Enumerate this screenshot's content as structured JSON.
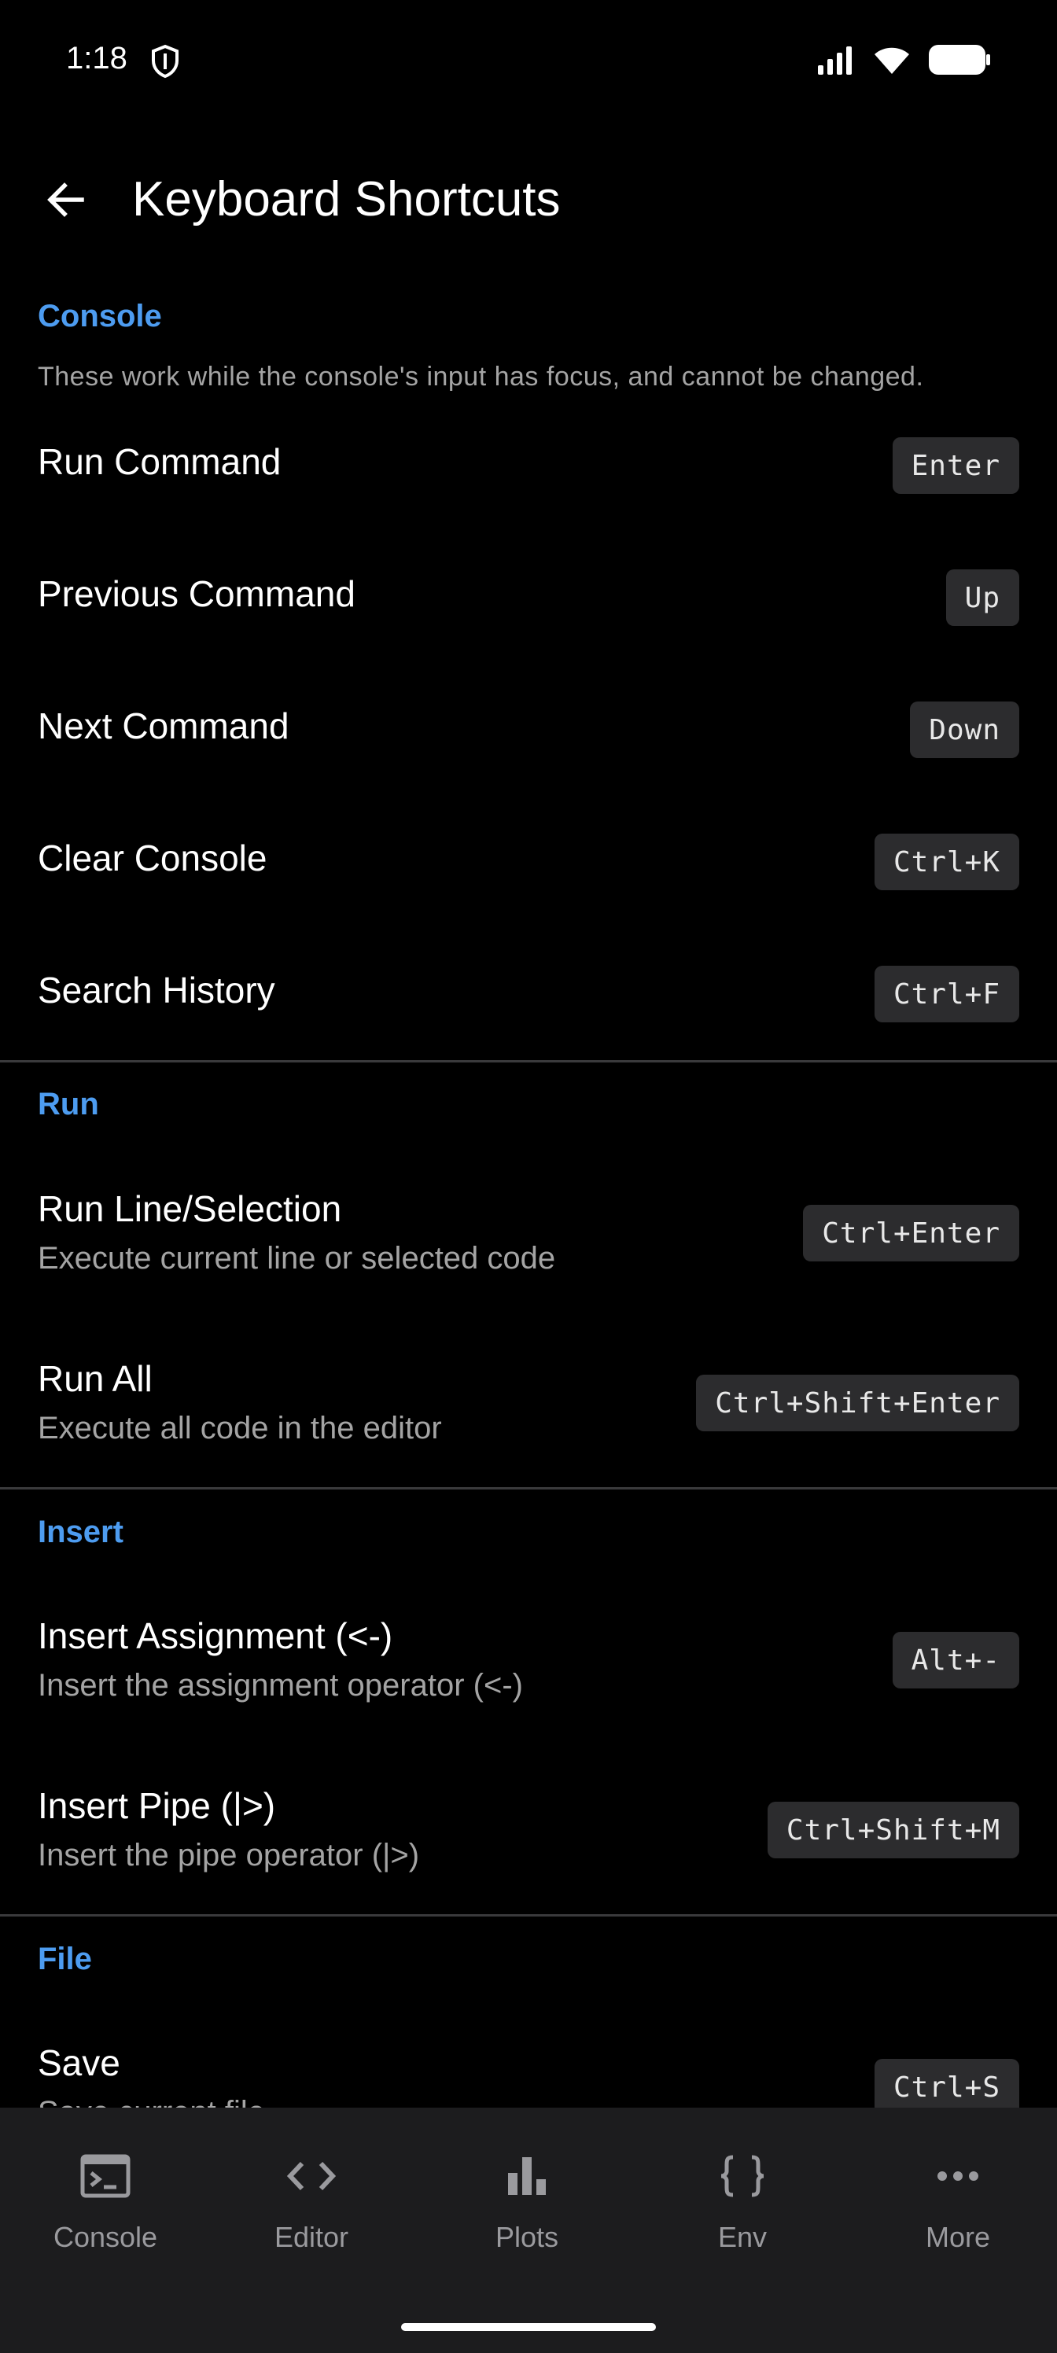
{
  "status": {
    "time": "1:18"
  },
  "header": {
    "title": "Keyboard Shortcuts"
  },
  "sections": {
    "console": {
      "title": "Console",
      "description": "These work while the console's input has focus, and cannot be changed.",
      "items": [
        {
          "label": "Run Command",
          "key": "Enter"
        },
        {
          "label": "Previous Command",
          "key": "Up"
        },
        {
          "label": "Next Command",
          "key": "Down"
        },
        {
          "label": "Clear Console",
          "key": "Ctrl+K"
        },
        {
          "label": "Search History",
          "key": "Ctrl+F"
        }
      ]
    },
    "run": {
      "title": "Run",
      "items": [
        {
          "label": "Run Line/Selection",
          "sub": "Execute current line or selected code",
          "key": "Ctrl+Enter"
        },
        {
          "label": "Run All",
          "sub": "Execute all code in the editor",
          "key": "Ctrl+Shift+Enter"
        }
      ]
    },
    "insert": {
      "title": "Insert",
      "items": [
        {
          "label": "Insert Assignment (<-)",
          "sub": "Insert the assignment operator (<-)",
          "key": "Alt+-"
        },
        {
          "label": "Insert Pipe (|>)",
          "sub": "Insert the pipe operator (|>)",
          "key": "Ctrl+Shift+M"
        }
      ]
    },
    "file": {
      "title": "File",
      "items": [
        {
          "label": "Save",
          "sub": "Save current file",
          "key": "Ctrl+S"
        }
      ]
    }
  },
  "nav": {
    "items": [
      {
        "label": "Console",
        "icon": "terminal-icon"
      },
      {
        "label": "Editor",
        "icon": "code-icon"
      },
      {
        "label": "Plots",
        "icon": "bar-chart-icon"
      },
      {
        "label": "Env",
        "icon": "braces-icon"
      },
      {
        "label": "More",
        "icon": "more-horiz-icon"
      }
    ]
  },
  "colors": {
    "accent": "#4d9cf0",
    "background": "#000000",
    "nav_background": "#1c1c1e",
    "key_background": "#2c2c2e"
  }
}
